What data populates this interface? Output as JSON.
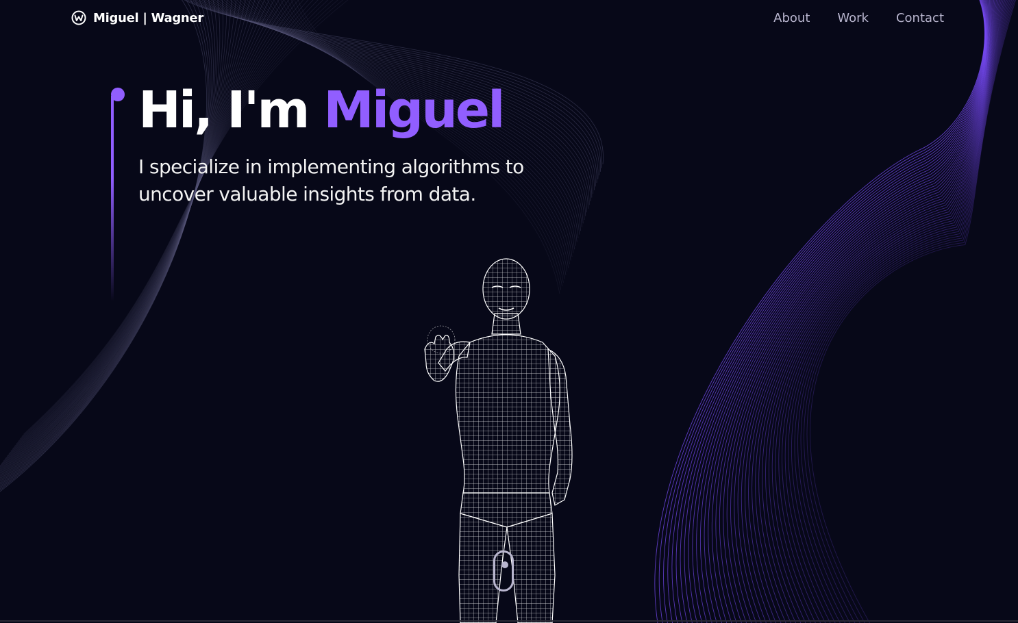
{
  "brand": {
    "name": "Miguel | Wagner",
    "logo_icon": "w-circle-logo-icon"
  },
  "nav": {
    "items": [
      {
        "label": "About"
      },
      {
        "label": "Work"
      },
      {
        "label": "Contact"
      }
    ]
  },
  "hero": {
    "greeting": "Hi, I'm ",
    "name": "Miguel",
    "subtitle": "I specialize in implementing algorithms to uncover valuable insights from data."
  },
  "scroll": {
    "icon": "mouse-scroll-icon"
  },
  "colors": {
    "background": "#070818",
    "accent": "#915eff",
    "text": "#ffffff",
    "muted": "#b9b6cf"
  }
}
